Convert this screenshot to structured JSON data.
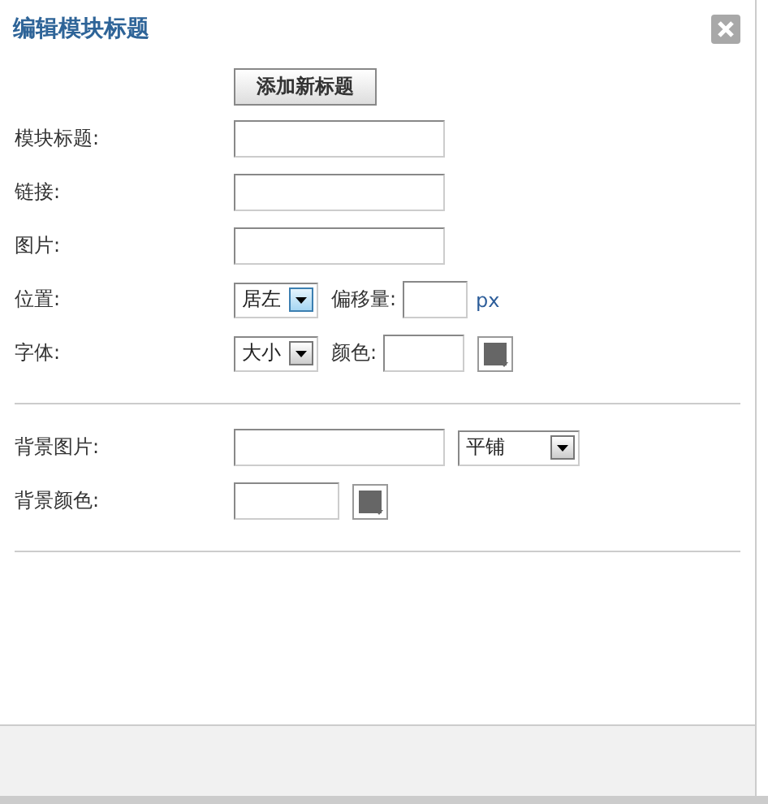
{
  "dialog": {
    "title": "编辑模块标题",
    "add_button": "添加新标题"
  },
  "sections": [
    {
      "rows": [
        {
          "label": "模块标题:",
          "controls": [
            {
              "kind": "widefield"
            }
          ]
        },
        {
          "label": "链接:",
          "controls": [
            {
              "kind": "widefield"
            }
          ]
        },
        {
          "label": "图片:",
          "controls": [
            {
              "kind": "widefield"
            }
          ]
        },
        {
          "label": "位置:",
          "controls": [
            {
              "kind": "dropdown",
              "value": "居左",
              "focused": true
            },
            {
              "kind": "text",
              "text": "偏移量:"
            },
            {
              "kind": "tinyfield"
            },
            {
              "kind": "unit",
              "text": "px"
            }
          ]
        },
        {
          "label": "字体:",
          "controls": [
            {
              "kind": "dropdown",
              "value": "大小",
              "focused": false
            },
            {
              "kind": "text",
              "text": "颜色:"
            },
            {
              "kind": "smallfield"
            },
            {
              "kind": "swatch"
            }
          ]
        }
      ]
    },
    {
      "rows": [
        {
          "label": "背景图片:",
          "controls": [
            {
              "kind": "widefield"
            },
            {
              "kind": "widedropdown",
              "value": "平铺",
              "focused": false
            }
          ]
        },
        {
          "label": "背景颜色:",
          "controls": [
            {
              "kind": "mediumfield"
            },
            {
              "kind": "swatch"
            }
          ]
        }
      ]
    }
  ]
}
